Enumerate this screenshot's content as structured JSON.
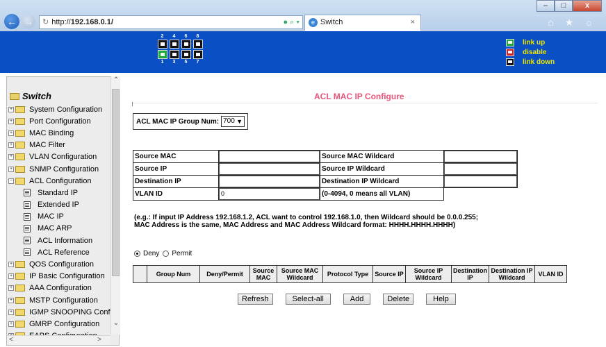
{
  "browser": {
    "address_prefix": "http://",
    "address_host": "192.168.0.1/",
    "tab_title": "Switch",
    "tab_close": "×",
    "toolbar_icons": "⌂ ★ ☼",
    "minimize": "–",
    "maximize": "□",
    "close": "x"
  },
  "banner": {
    "top_numbers": [
      "2",
      "4",
      "6",
      "8"
    ],
    "bottom_numbers": [
      "1",
      "3",
      "5",
      "7"
    ],
    "ports_top": [
      "down",
      "down",
      "down",
      "down"
    ],
    "ports_bottom": [
      "up",
      "down",
      "down",
      "down"
    ],
    "legend": {
      "link_up": "link up",
      "disable": "disable",
      "link_down": "link down"
    }
  },
  "sidebar": {
    "root": "Switch",
    "items": [
      {
        "label": "System Configuration",
        "kind": "folder",
        "expanded": false
      },
      {
        "label": "Port Configuration",
        "kind": "folder",
        "expanded": false
      },
      {
        "label": "MAC Binding",
        "kind": "folder",
        "expanded": false
      },
      {
        "label": "MAC Filter",
        "kind": "folder",
        "expanded": false
      },
      {
        "label": "VLAN Configuration",
        "kind": "folder",
        "expanded": false
      },
      {
        "label": "SNMP Configuration",
        "kind": "folder",
        "expanded": false
      },
      {
        "label": "ACL Configuration",
        "kind": "folder",
        "expanded": true
      },
      {
        "label": "Standard IP",
        "kind": "doc"
      },
      {
        "label": "Extended IP",
        "kind": "doc"
      },
      {
        "label": "MAC IP",
        "kind": "doc"
      },
      {
        "label": "MAC ARP",
        "kind": "doc"
      },
      {
        "label": "ACL Information",
        "kind": "doc"
      },
      {
        "label": "ACL Reference",
        "kind": "doc"
      },
      {
        "label": "QOS Configuration",
        "kind": "folder",
        "expanded": false
      },
      {
        "label": "IP Basic Configuration",
        "kind": "folder",
        "expanded": false
      },
      {
        "label": "AAA Configuration",
        "kind": "folder",
        "expanded": false
      },
      {
        "label": "MSTP Configuration",
        "kind": "folder",
        "expanded": false
      },
      {
        "label": "IGMP SNOOPING Confi",
        "kind": "folder",
        "expanded": false
      },
      {
        "label": "GMRP Configuration",
        "kind": "folder",
        "expanded": false
      },
      {
        "label": "EAPS Configuration",
        "kind": "folder",
        "expanded": false
      }
    ]
  },
  "main": {
    "title": "ACL MAC IP Configure",
    "group_label": "ACL MAC IP Group Num:",
    "group_value": "700",
    "form": {
      "source_mac": "Source MAC",
      "source_mac_wildcard": "Source MAC Wildcard",
      "source_ip": "Source IP",
      "source_ip_wildcard": "Source IP Wildcard",
      "destination_ip": "Destination IP",
      "destination_ip_wildcard": "Destination IP Wildcard",
      "vlan_id": "VLAN ID",
      "vlan_id_value": "0",
      "vlan_hint": "(0-4094, 0 means all VLAN)"
    },
    "note": "(e.g.: If input IP Address 192.168.1.2, ACL want to control 192.168.1.0, then Wildcard should be 0.0.0.255; MAC Address is the same, MAC Address and MAC Address Wildcard format: HHHH.HHHH.HHHH)",
    "radio_deny": "Deny",
    "radio_permit": "Permit",
    "columns": [
      "",
      "Group Num",
      "Deny/Permit",
      "Source MAC",
      "Source MAC Wildcard",
      "Protocol Type",
      "Source IP",
      "Source IP Wildcard",
      "Destination IP",
      "Destination IP Wildcard",
      "VLAN ID"
    ],
    "buttons": {
      "refresh": "Refresh",
      "select_all": "Select-all",
      "add": "Add",
      "delete": "Delete",
      "help": "Help"
    }
  }
}
